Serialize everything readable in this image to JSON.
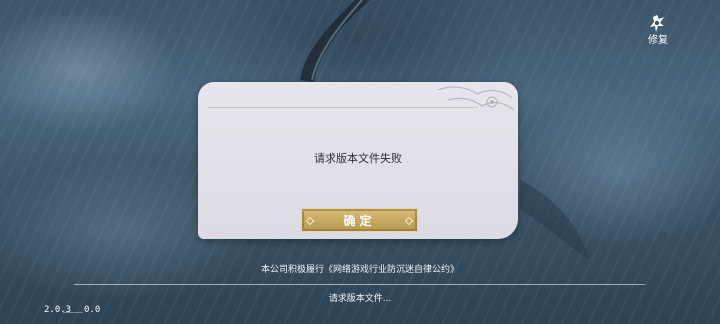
{
  "repair": {
    "label": "修复",
    "icon": "repair-icon"
  },
  "dialog": {
    "message": "请求版本文件失败",
    "confirm_label": "确定"
  },
  "footer": {
    "covenant": "本公司积极履行《网络游戏行业防沉迷自律公约》",
    "status": "请求版本文件...",
    "progress": 0
  },
  "version": {
    "left": "2.0.3",
    "right": "0.0"
  },
  "colors": {
    "dialog_bg": "#e2e0e8",
    "button_gold": "#c7a860",
    "text_light": "#ffffff"
  }
}
